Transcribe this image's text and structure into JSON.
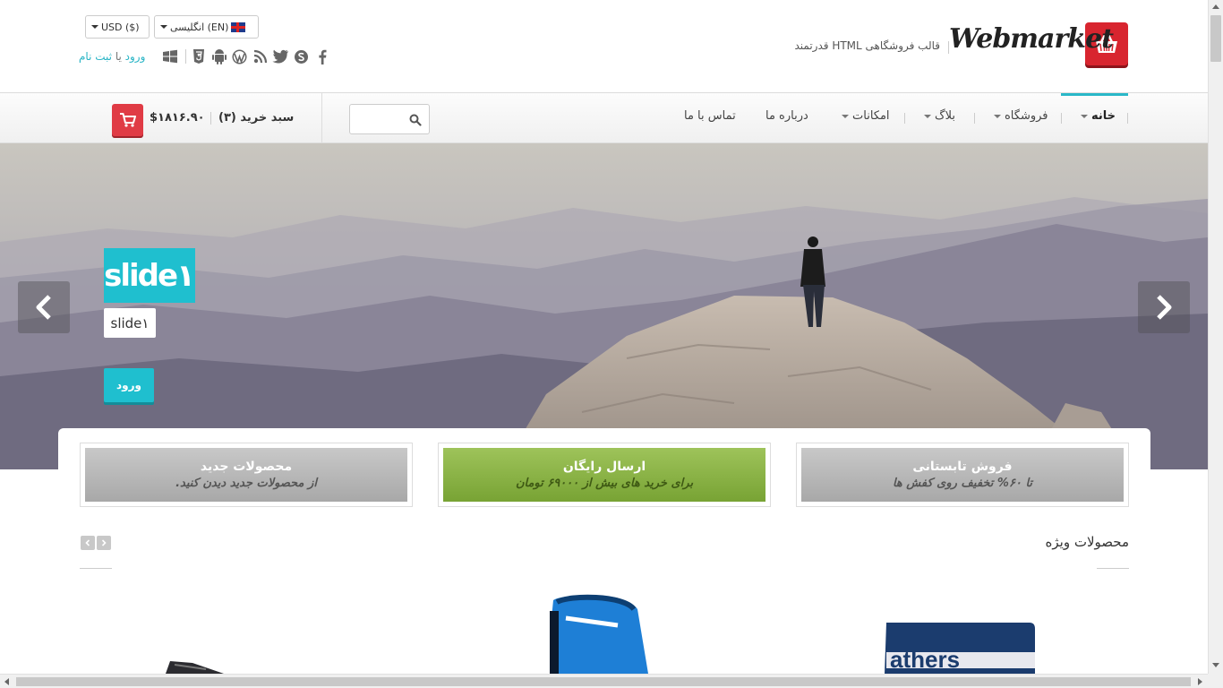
{
  "header": {
    "logo_text": "Webmarket",
    "tagline": "قالب فروشگاهی HTML قدرتمند",
    "language": "انگلیسی (EN)",
    "currency": "USD ($)",
    "login_link": "ورود",
    "login_or": "یا",
    "register_link": "ثبت نام",
    "social_icons": [
      "facebook-icon",
      "skype-icon",
      "twitter-icon",
      "rss-icon",
      "wordpress-icon",
      "android-icon",
      "html5-icon",
      "windows-icon"
    ]
  },
  "nav": {
    "items": [
      {
        "label": "خانه",
        "dropdown": true,
        "active": true
      },
      {
        "label": "فروشگاه",
        "dropdown": true
      },
      {
        "label": "بلاگ",
        "dropdown": true
      },
      {
        "label": "امکانات",
        "dropdown": true
      },
      {
        "label": "درباره ما",
        "dropdown": false
      },
      {
        "label": "تماس با ما",
        "dropdown": false
      }
    ],
    "search_placeholder": "",
    "cart_label": "سبد خرید (۳)",
    "cart_total": "$۱۸۱۶.۹۰"
  },
  "slider": {
    "title": "slide۱",
    "subtitle": "slide۱",
    "button": "ورود"
  },
  "promos": [
    {
      "title": "فروش تابستانی",
      "text": "تا ۶۰% تخفیف روی کفش ها",
      "style": "grey"
    },
    {
      "title": "ارسال رایگان",
      "text": "برای خرید های بیش از ۶۹۰۰۰ تومان",
      "style": "green"
    },
    {
      "title": "محصولات جدید",
      "text": "از محصولات جدید دیدن کنید.",
      "style": "grey"
    }
  ],
  "featured": {
    "title": "محصولات ویژه"
  },
  "colors": {
    "accent": "#1fbfcf",
    "brand_red": "#d8252f",
    "promo_green": "#8bb548"
  }
}
